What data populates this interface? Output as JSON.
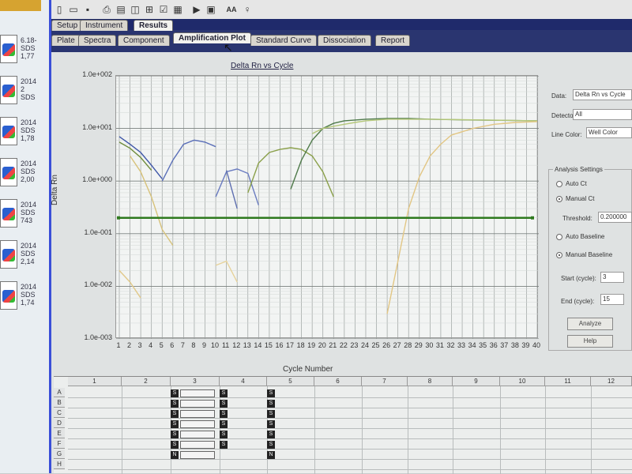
{
  "desktop": {
    "files": [
      {
        "line1": "6.18-",
        "line2": "SDS",
        "line3": "1,77"
      },
      {
        "line1": "2014",
        "line2": "2",
        "line3": "SDS"
      },
      {
        "line1": "2014",
        "line2": "SDS",
        "line3": "1,78"
      },
      {
        "line1": "2014",
        "line2": "SDS",
        "line3": "2,00"
      },
      {
        "line1": "2014",
        "line2": "SDS",
        "line3": "743"
      },
      {
        "line1": "2014",
        "line2": "SDS",
        "line3": "2,14"
      },
      {
        "line1": "2014",
        "line2": "SDS",
        "line3": "1,74"
      }
    ]
  },
  "tabs_top": [
    "Setup",
    "Instrument",
    "Results"
  ],
  "tabs_sub": [
    "Plate",
    "Spectra",
    "Component",
    "Amplification Plot",
    "Standard Curve",
    "Dissociation",
    "Report"
  ],
  "active_top": "Results",
  "active_sub": "Amplification Plot",
  "right": {
    "data_label": "Data:",
    "data_value": "Delta Rn vs Cycle",
    "detector_label": "Detector:",
    "detector_value": "All",
    "line_color_label": "Line Color:",
    "line_color_value": "Well Color",
    "analysis_title": "Analysis Settings",
    "auto_ct": "Auto Ct",
    "manual_ct": "Manual Ct",
    "threshold_label": "Threshold:",
    "threshold_value": "0.200000",
    "auto_baseline": "Auto Baseline",
    "manual_baseline": "Manual Baseline",
    "start_label": "Start (cycle):",
    "start_value": "3",
    "end_label": "End (cycle):",
    "end_value": "15",
    "analyze_button": "Analyze",
    "help_button": "Help"
  },
  "plate": {
    "columns": [
      "1",
      "2",
      "3",
      "4",
      "5",
      "6",
      "7",
      "8",
      "9",
      "10",
      "11",
      "12"
    ],
    "rows": [
      "A",
      "B",
      "C",
      "D",
      "E",
      "F",
      "G",
      "H"
    ],
    "col3_tags": [
      "S",
      "S",
      "S",
      "S",
      "S",
      "S",
      "N"
    ],
    "col4_tags": [
      "S",
      "S",
      "S",
      "S",
      "S",
      "S"
    ],
    "col5_tags": [
      "S",
      "S",
      "S",
      "S",
      "S",
      "S",
      "N"
    ]
  },
  "chart_data": {
    "type": "line",
    "title": "Delta Rn vs Cycle",
    "xlabel": "Cycle Number",
    "ylabel": "Delta Rn",
    "y_scale": "log",
    "ylim": [
      0.001,
      100
    ],
    "y_ticks": [
      "1.0e+002",
      "1.0e+001",
      "1.0e+000",
      "1.0e-001",
      "1.0e-002",
      "1.0e-003"
    ],
    "xlim": [
      1,
      40
    ],
    "x_ticks": [
      "1",
      "2",
      "3",
      "4",
      "5",
      "6",
      "7",
      "8",
      "9",
      "10",
      "11",
      "12",
      "13",
      "14",
      "15",
      "16",
      "17",
      "18",
      "19",
      "20",
      "21",
      "22",
      "23",
      "24",
      "25",
      "26",
      "27",
      "28",
      "29",
      "30",
      "31",
      "32",
      "33",
      "34",
      "35",
      "36",
      "37",
      "38",
      "39",
      "40"
    ],
    "grid": true,
    "threshold": 0.2,
    "threshold_color": "#2f7a1f",
    "series": [
      {
        "color": "#3f57a8",
        "x": [
          1,
          2,
          3,
          4,
          5
        ],
        "y": [
          7,
          5,
          3.5,
          2,
          1.1
        ]
      },
      {
        "color": "#6f8c3c",
        "x": [
          1,
          2,
          3,
          4
        ],
        "y": [
          5.5,
          4.2,
          2.8,
          1.6
        ]
      },
      {
        "color": "#5a6fb8",
        "x": [
          5,
          6,
          7,
          8,
          9,
          10
        ],
        "y": [
          1.0,
          2.5,
          5.0,
          6.0,
          5.5,
          4.5
        ]
      },
      {
        "color": "#6a7cc0",
        "x": [
          10,
          11,
          12,
          13,
          14
        ],
        "y": [
          0.5,
          1.5,
          1.7,
          1.4,
          0.35
        ]
      },
      {
        "color": "#5e6fb0",
        "x": [
          11,
          12
        ],
        "y": [
          1.6,
          0.3
        ]
      },
      {
        "color": "#8aa04a",
        "x": [
          13,
          14,
          15,
          16,
          17,
          18,
          19,
          20,
          21
        ],
        "y": [
          0.6,
          2.2,
          3.5,
          4.0,
          4.3,
          4.0,
          3.0,
          1.5,
          0.5
        ]
      },
      {
        "color": "#4f7a4a",
        "x": [
          17,
          18,
          19,
          20,
          21,
          22,
          24,
          26,
          28,
          30,
          34,
          40
        ],
        "y": [
          0.7,
          2.5,
          6.0,
          10,
          12.5,
          14,
          15,
          15.5,
          15.5,
          15,
          14.5,
          14
        ]
      },
      {
        "color": "#b5c87a",
        "x": [
          19,
          20,
          21,
          22,
          23,
          24,
          26,
          30,
          40
        ],
        "y": [
          8,
          10,
          11,
          12,
          13,
          14,
          15,
          15,
          14
        ]
      },
      {
        "color": "#d7c27a",
        "x": [
          2,
          3,
          4,
          5,
          6
        ],
        "y": [
          3,
          1.5,
          0.5,
          0.12,
          0.06
        ]
      },
      {
        "color": "#e1c98a",
        "x": [
          1,
          2,
          3
        ],
        "y": [
          0.02,
          0.012,
          0.006
        ]
      },
      {
        "color": "#e6d29a",
        "x": [
          10,
          11,
          12
        ],
        "y": [
          0.025,
          0.03,
          0.012
        ]
      },
      {
        "color": "#e2c684",
        "x": [
          26,
          27,
          28,
          29,
          30,
          31,
          32,
          34,
          36,
          38,
          40
        ],
        "y": [
          0.003,
          0.03,
          0.3,
          1.2,
          3,
          5,
          7.5,
          10,
          12,
          13,
          13.5
        ]
      }
    ]
  }
}
